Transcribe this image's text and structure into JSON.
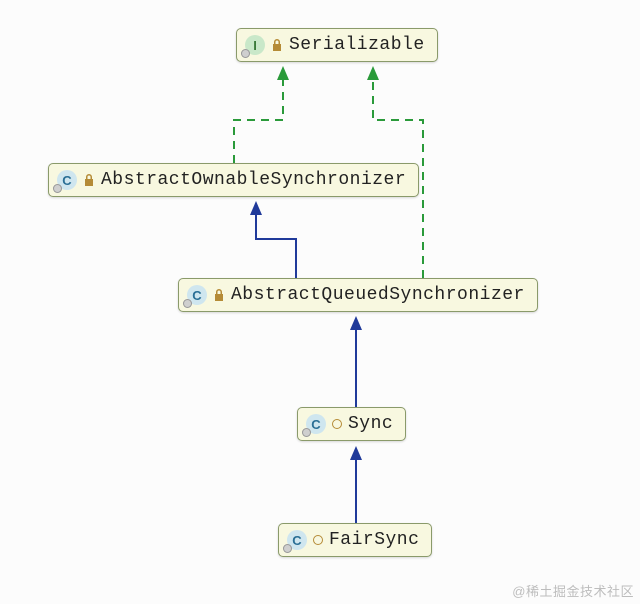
{
  "diagram": {
    "nodes": {
      "serializable": {
        "label": "Serializable",
        "kind": "interface",
        "badge": "I",
        "modifier": "locked"
      },
      "abstractOwnableSync": {
        "label": "AbstractOwnableSynchronizer",
        "kind": "class",
        "badge": "C",
        "modifier": "locked"
      },
      "abstractQueuedSync": {
        "label": "AbstractQueuedSynchronizer",
        "kind": "class",
        "badge": "C",
        "modifier": "locked"
      },
      "sync": {
        "label": "Sync",
        "kind": "class",
        "badge": "C",
        "modifier": "package"
      },
      "fairSync": {
        "label": "FairSync",
        "kind": "class",
        "badge": "C",
        "modifier": "package"
      }
    },
    "edges": [
      {
        "from": "abstractOwnableSync",
        "to": "serializable",
        "relation": "implements"
      },
      {
        "from": "abstractQueuedSync",
        "to": "serializable",
        "relation": "implements"
      },
      {
        "from": "abstractQueuedSync",
        "to": "abstractOwnableSync",
        "relation": "extends"
      },
      {
        "from": "sync",
        "to": "abstractQueuedSync",
        "relation": "extends"
      },
      {
        "from": "fairSync",
        "to": "sync",
        "relation": "extends"
      }
    ]
  },
  "colors": {
    "extends": "#203a9a",
    "implements": "#2a9a3a",
    "node_fill": "#f8f8e0",
    "node_border": "#8a9a6a"
  },
  "watermark": "@稀土掘金技术社区"
}
